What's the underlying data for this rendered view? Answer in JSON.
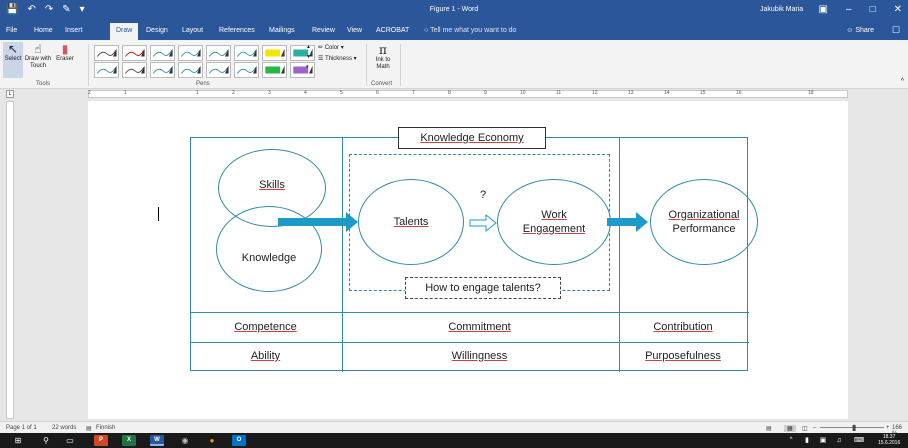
{
  "window": {
    "title": "Figure 1 - Word",
    "user": "Jakubik Maria"
  },
  "tabs": [
    "File",
    "Home",
    "Insert",
    "Draw",
    "Design",
    "Layout",
    "References",
    "Mailings",
    "Review",
    "View",
    "ACROBAT"
  ],
  "active_tab": "Draw",
  "tell_me": "Tell me what you want to do",
  "share_label": "Share",
  "ribbon": {
    "tools": {
      "select": "Select",
      "draw_with_touch": "Draw with Touch",
      "eraser": "Eraser",
      "group_label": "Tools"
    },
    "pens": {
      "group_label": "Pens",
      "colors": [
        "#444444",
        "#c00000",
        "#2e8ca8",
        "#2e8ca8",
        "#2e8ca8",
        "#2e8ca8",
        "#2e8ca8",
        "#444444",
        "#2e8ca8",
        "#2e8ca8",
        "#2e8ca8",
        "#2e8ca8"
      ],
      "highlighters": [
        "#f2e600",
        "#2ab0a0",
        "#28b84a",
        "#a064c8"
      ]
    },
    "color_label": "Color",
    "thickness_label": "Thickness",
    "ink_to_math": "Ink to Math",
    "convert_label": "Convert"
  },
  "figure": {
    "title": "Knowledge Economy",
    "skills": "Skills",
    "knowledge": "Knowledge",
    "talents": "Talents",
    "question_mark": "?",
    "work_engagement_1": "Work",
    "work_engagement_2": "Engagement",
    "org_perf_1": "Organizational",
    "org_perf_2": "Performance",
    "question": "How to engage talents?",
    "row1": [
      "Competence",
      "Commitment",
      "Contribution"
    ],
    "row2": [
      "Ability",
      "Willingness",
      "Purposefulness"
    ]
  },
  "status": {
    "page": "Page 1 of 1",
    "words": "22 words",
    "language": "Finnish",
    "zoom": "166 %"
  },
  "taskbar": {
    "time": "18.37",
    "date": "15.6.2016"
  }
}
